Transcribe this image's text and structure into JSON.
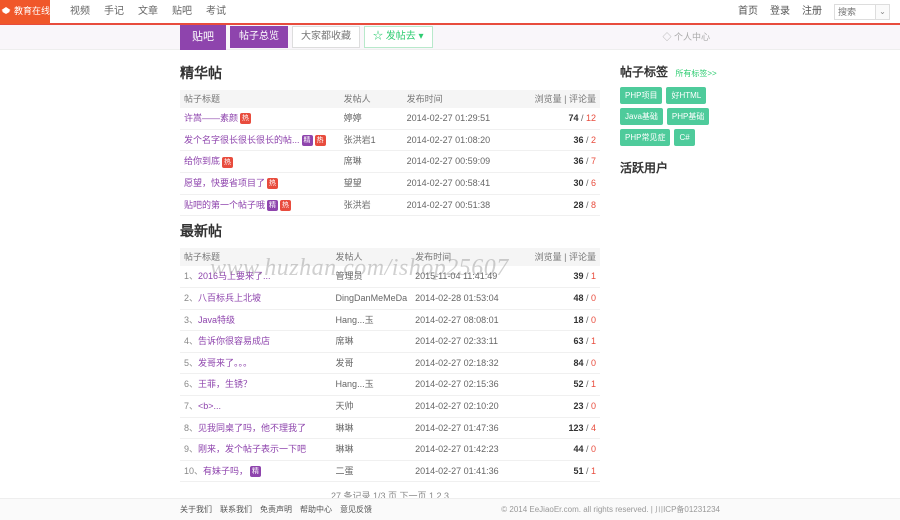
{
  "brand": "教育在线",
  "topnav": [
    "视频",
    "手记",
    "文章",
    "贴吧",
    "考试"
  ],
  "topright": {
    "home": "首页",
    "login": "登录",
    "register": "注册"
  },
  "search": {
    "placeholder": "搜索",
    "btn": "⌄"
  },
  "tabbar": {
    "current": "贴吧",
    "tabs": [
      "帖子总览",
      "大家都收藏"
    ],
    "post": "☆ 发帖去 ▾",
    "personal": "◇ 个人中心"
  },
  "essence": {
    "heading": "精华帖",
    "cols": [
      "帖子标题",
      "发帖人",
      "发布时间",
      "浏览量 | 评论量"
    ],
    "rows": [
      {
        "title": "许嵩——素颜",
        "badges": [
          "hot"
        ],
        "user": "婷婷",
        "time": "2014-02-27  01:29:51",
        "views": "74",
        "reply": "12"
      },
      {
        "title": "发个名字很长很长很长的帖...",
        "badges": [
          "jing",
          "hot"
        ],
        "user": "张洪岩1",
        "time": "2014-02-27  01:08:20",
        "views": "36",
        "reply": "2"
      },
      {
        "title": "给你到底",
        "badges": [
          "hot"
        ],
        "user": "席琳",
        "time": "2014-02-27  00:59:09",
        "views": "36",
        "reply": "7"
      },
      {
        "title": "愿望，快要省项目了",
        "badges": [
          "hot"
        ],
        "user": "望望",
        "time": "2014-02-27  00:58:41",
        "views": "30",
        "reply": "6"
      },
      {
        "title": "贴吧的第一个帖子哦",
        "badges": [
          "jing",
          "hot"
        ],
        "user": "张洪岩",
        "time": "2014-02-27  00:51:38",
        "views": "28",
        "reply": "8"
      }
    ]
  },
  "latest": {
    "heading": "最新帖",
    "cols": [
      "帖子标题",
      "发帖人",
      "发布时间",
      "浏览量 | 评论量"
    ],
    "rows": [
      {
        "idx": "1、",
        "title": "2016马上要来了...",
        "badges": [],
        "user": "管理员",
        "time": "2015-11-04  11:41:49",
        "views": "39",
        "reply": "1"
      },
      {
        "idx": "2、",
        "title": "八百标兵上北坡",
        "badges": [],
        "user": "DingDanMeMeDa",
        "time": "2014-02-28  01:53:04",
        "views": "48",
        "reply": "0"
      },
      {
        "idx": "3、",
        "title": "Java特级",
        "badges": [],
        "user": "Hang...玉",
        "time": "2014-02-27  08:08:01",
        "views": "18",
        "reply": "0"
      },
      {
        "idx": "4、",
        "title": "告诉你很容易成店",
        "badges": [],
        "user": "席琳",
        "time": "2014-02-27  02:33:11",
        "views": "63",
        "reply": "1"
      },
      {
        "idx": "5、",
        "title": "发哥来了。。。",
        "badges": [],
        "user": "发哥",
        "time": "2014-02-27  02:18:32",
        "views": "84",
        "reply": "0"
      },
      {
        "idx": "6、",
        "title": "王菲，生锈？",
        "badges": [],
        "user": "Hang...玉",
        "time": "2014-02-27  02:15:36",
        "views": "52",
        "reply": "1"
      },
      {
        "idx": "7、",
        "title": "<b>...",
        "badges": [],
        "user": "天帅",
        "time": "2014-02-27  02:10:20",
        "views": "23",
        "reply": "0"
      },
      {
        "idx": "8、",
        "title": "见我同桌了吗，他不理我了",
        "badges": [],
        "user": "琳琳",
        "time": "2014-02-27  01:47:36",
        "views": "123",
        "reply": "4"
      },
      {
        "idx": "9、",
        "title": "刚来，发个帖子表示一下吧",
        "badges": [],
        "user": "琳琳",
        "time": "2014-02-27  01:42:23",
        "views": "44",
        "reply": "0"
      },
      {
        "idx": "10、",
        "title": "有妹子吗，",
        "badges": [
          "jing"
        ],
        "user": "二蛋",
        "time": "2014-02-27  01:41:36",
        "views": "51",
        "reply": "1"
      }
    ],
    "pager": "27 条记录 1/3 页 下一页 1 2 3"
  },
  "sidebar": {
    "tags_heading": "帖子标签",
    "tags_more": "所有标签>>",
    "tags": [
      "PHP项目",
      "好HTML",
      "Java基础",
      "PHP基础",
      "PHP常见症",
      "C#"
    ],
    "active_heading": "活跃用户"
  },
  "footer": {
    "links": [
      "关于我们",
      "联系我们",
      "免责声明",
      "帮助中心",
      "意见反馈"
    ],
    "copy": "© 2014 EeJiaoEr.com. all rights reserved. | 川ICP备01231234"
  },
  "watermark": "www.huzhan.com/ishop25607"
}
